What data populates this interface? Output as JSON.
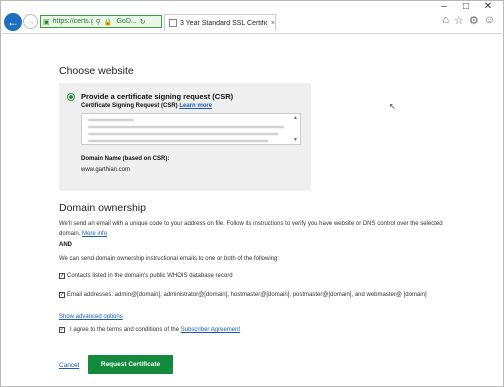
{
  "window": {
    "controls": [
      "–",
      "□",
      "✕"
    ]
  },
  "browser": {
    "address_url": "https://certs.god...",
    "address_site": "GoD...",
    "tab_label": "3 Year Standard SSL Certific...",
    "tab_close": "×"
  },
  "choose_website": {
    "heading": "Choose website",
    "radio_title": "Provide a certificate signing request (CSR)",
    "csr_label": "Certificate Signing Request (CSR)",
    "learn_more": "Learn more",
    "domain_label": "Domain Name (based on CSR):",
    "domain_value": "www.garthian.com"
  },
  "domain_ownership": {
    "heading": "Domain ownership",
    "para1": "We'll send an email with a unique code to your address on file. Follow its instructions to verify you have website or DNS control over the selected domain.",
    "more_info": "More info",
    "and": "AND",
    "para2": "We can send domain ownership instructional emails to one or both of the following:",
    "option1": "Contacts listed in the domain's public WHOIS database record",
    "option2": "Email addresses: admin@[domain], administrator@[domain], hostmaster@[domain], postmaster@[domain], and webmaster@ [domain]",
    "advanced": "Show advanced options",
    "agree_prefix": "I agree to the terms and conditions of the",
    "agreement_link": "Subscriber Agreement"
  },
  "actions": {
    "cancel": "Cancel",
    "request": "Request Certificate"
  },
  "checkmark": "✓",
  "colors": {
    "accent_green": "#138a3c",
    "link_blue": "#1a5bb5",
    "back_button": "#1e6fbf"
  }
}
